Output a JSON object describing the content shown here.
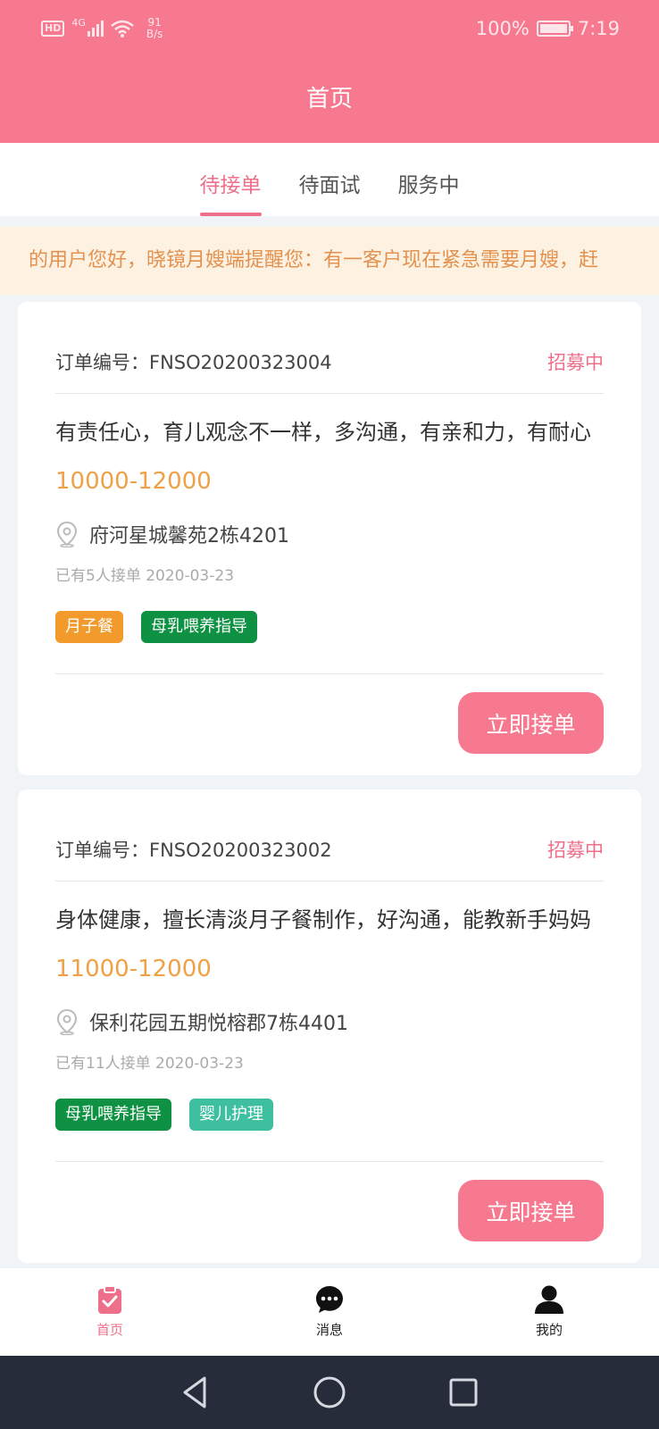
{
  "status_bar": {
    "hd": "HD",
    "signal": "4G",
    "speed_value": "91",
    "speed_unit": "B/s",
    "battery": "100%",
    "time": "7:19"
  },
  "header": {
    "title": "首页"
  },
  "tabs": [
    {
      "label": "待接单",
      "active": true
    },
    {
      "label": "待面试",
      "active": false
    },
    {
      "label": "服务中",
      "active": false
    }
  ],
  "notice": {
    "text": "的用户您好，晓镜月嫂端提醒您：有一客户现在紧急需要月嫂，赶"
  },
  "orders": [
    {
      "order_label": "订单编号：FNSO20200323004",
      "status": "招募中",
      "description": "有责任心，育儿观念不一样，多沟通，有亲和力，有耐心",
      "salary": "10000-12000",
      "address": "府河星城馨苑2栋4201",
      "meta": "已有5人接单 2020-03-23",
      "tags": [
        {
          "label": "月子餐",
          "color": "#f39a2c"
        },
        {
          "label": "母乳喂养指导",
          "color": "#0e9142"
        }
      ],
      "button": "立即接单"
    },
    {
      "order_label": "订单编号：FNSO20200323002",
      "status": "招募中",
      "description": "身体健康，擅长清淡月子餐制作，好沟通，能教新手妈妈",
      "salary": "11000-12000",
      "address": "保利花园五期悦榕郡7栋4401",
      "meta": "已有11人接单 2020-03-23",
      "tags": [
        {
          "label": "母乳喂养指导",
          "color": "#0e9142"
        },
        {
          "label": "婴儿护理",
          "color": "#3dbfa0"
        }
      ],
      "button": "立即接单"
    }
  ],
  "bottom_nav": [
    {
      "label": "首页",
      "icon": "clipboard-check-icon",
      "active": true
    },
    {
      "label": "消息",
      "icon": "chat-bubble-icon",
      "active": false
    },
    {
      "label": "我的",
      "icon": "person-icon",
      "active": false
    }
  ],
  "colors": {
    "brand": "#f77990",
    "accent_text": "#ee6f8a",
    "salary": "#f0a046",
    "notice_bg": "#fdf2e2",
    "notice_text": "#e3914f"
  }
}
